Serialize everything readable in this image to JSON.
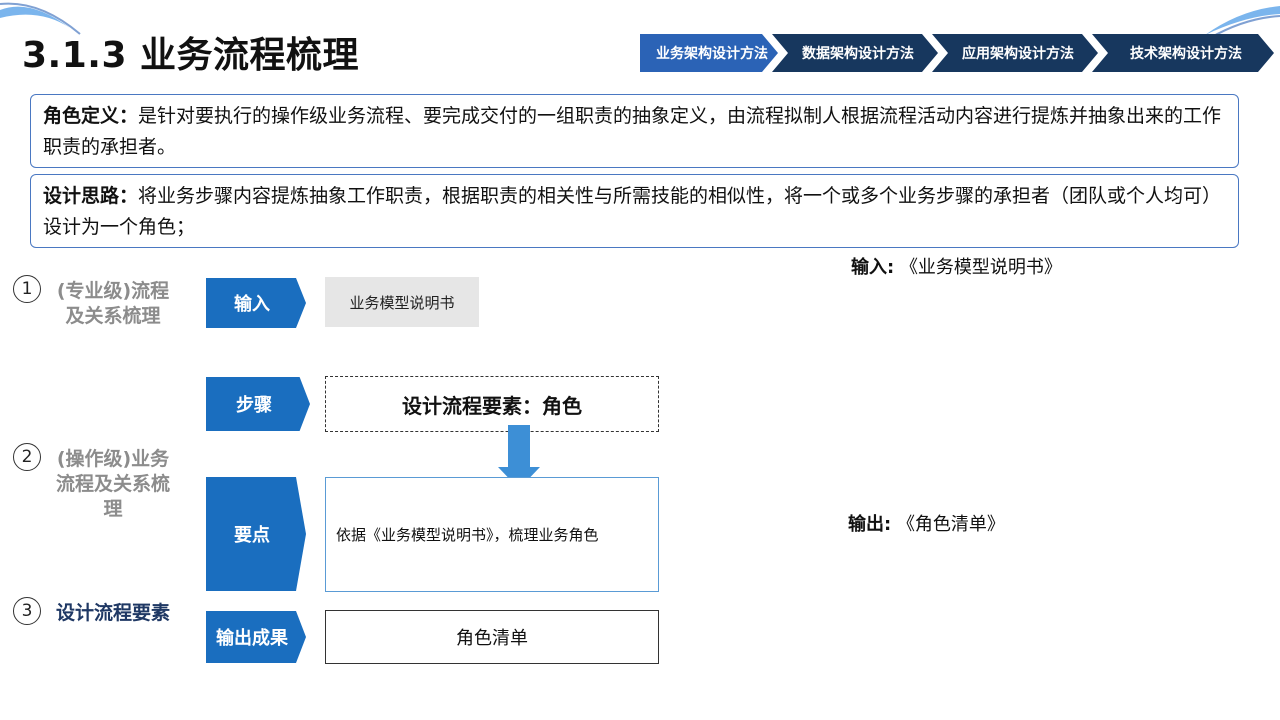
{
  "title": "3.1.3 业务流程梳理",
  "breadcrumb": [
    {
      "label": "业务架构设计方法",
      "active": true
    },
    {
      "label": "数据架构设计方法",
      "active": false
    },
    {
      "label": "应用架构设计方法",
      "active": false
    },
    {
      "label": "技术架构设计方法",
      "active": false
    }
  ],
  "definitions": {
    "role_label": "角色定义：",
    "role_text": "是针对要执行的操作级业务流程、要完成交付的一组职责的抽象定义，由流程拟制人根据流程活动内容进行提炼并抽象出来的工作职责的承担者。",
    "design_label": "设计思路：",
    "design_text": "将业务步骤内容提炼抽象工作职责，根据职责的相关性与所需技能的相似性，将一个或多个业务步骤的承担者（团队或个人均可）设计为一个角色；"
  },
  "levels": [
    {
      "num": "1",
      "text": "(专业级)流程及关系梳理"
    },
    {
      "num": "2",
      "text": "(操作级)业务流程及关系梳理"
    },
    {
      "num": "3",
      "text": "设计流程要素"
    }
  ],
  "tags": {
    "input": "输入",
    "step": "步骤",
    "key_points": "要点",
    "output": "输出成果"
  },
  "boxes": {
    "input_value": "业务模型说明书",
    "step_value": "设计流程要素：角色",
    "key_points_value": "依据《业务模型说明书》，梳理业务角色",
    "output_value": "角色清单"
  },
  "side_notes": {
    "input_label": "输入:",
    "input_value": "《业务模型说明书》",
    "output_label": "输出:",
    "output_value": "《角色清单》"
  },
  "colors": {
    "accent": "#1a6ebf",
    "crumb_active": "#2b63b6",
    "crumb_inactive": "#17375e",
    "border": "#4a78c2"
  }
}
